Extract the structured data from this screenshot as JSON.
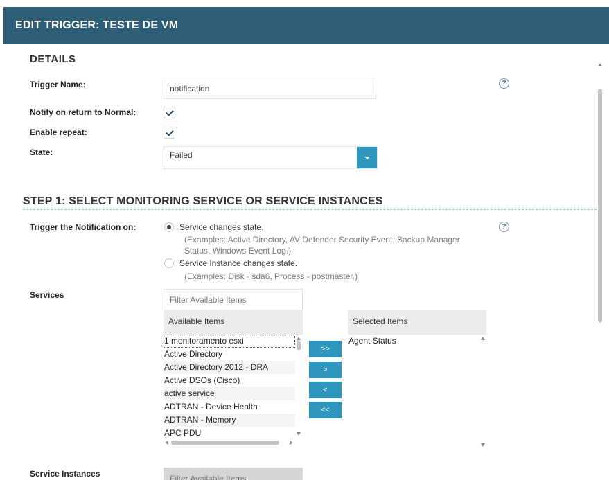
{
  "header": {
    "title": "EDIT TRIGGER: TESTE DE VM"
  },
  "details": {
    "heading": "DETAILS",
    "trigger_name_label": "Trigger Name:",
    "trigger_name_value": "notification",
    "notify_normal_label": "Notify on return to Normal:",
    "notify_normal_checked": true,
    "enable_repeat_label": "Enable repeat:",
    "enable_repeat_checked": true,
    "state_label": "State:",
    "state_value": "Failed",
    "help_glyph": "?"
  },
  "step1": {
    "heading": "STEP 1:  SELECT MONITORING SERVICE OR SERVICE INSTANCES",
    "trigger_on_label": "Trigger the Notification on:",
    "option_service": "Service changes state.",
    "option_service_examples_1": "(Examples: Active Directory, AV Defender Security Event, Backup Manager",
    "option_service_examples_2": "Status, Windows Event Log.)",
    "option_instance": "Service Instance changes state.",
    "option_instance_examples": "(Examples: Disk - sda6, Process - postmaster.)",
    "selected_option": "service"
  },
  "services": {
    "label": "Services",
    "filter_placeholder": "Filter Available Items",
    "available_header": "Available Items",
    "selected_header": "Selected Items",
    "available_items": [
      "1 monitoramento esxi",
      "Active Directory",
      "Active Directory 2012 - DRA",
      "Active DSOs (Cisco)",
      "active service",
      "ADTRAN - Device Health",
      "ADTRAN - Memory",
      "APC PDU"
    ],
    "selected_items": [
      "Agent Status"
    ],
    "buttons": {
      "add_all": ">>",
      "add": ">",
      "remove": "<",
      "remove_all": "<<"
    }
  },
  "service_instances": {
    "label": "Service Instances",
    "filter_placeholder": "Filter Available Items"
  },
  "colors": {
    "header_bg": "#2e5d78",
    "button_bg": "#2f97bd",
    "dashed_rule": "#9ec9c2"
  }
}
